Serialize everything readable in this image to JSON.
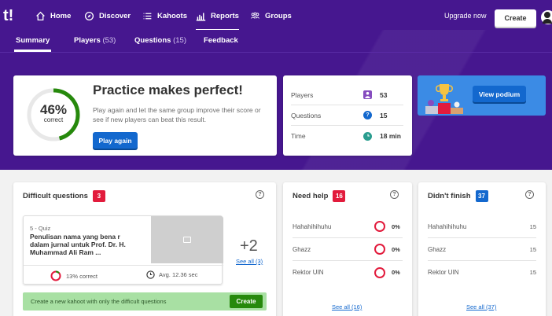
{
  "app": {
    "logo": "t!"
  },
  "nav": {
    "items": [
      {
        "label": "Home",
        "icon": "home-icon"
      },
      {
        "label": "Discover",
        "icon": "compass-icon"
      },
      {
        "label": "Kahoots",
        "icon": "list-icon"
      },
      {
        "label": "Reports",
        "icon": "bar-chart-icon",
        "active": true
      },
      {
        "label": "Groups",
        "icon": "groups-icon"
      }
    ],
    "upgrade_label": "Upgrade now",
    "create_label": "Create"
  },
  "tabs": [
    {
      "label": "Summary",
      "count": "",
      "active": true
    },
    {
      "label": "Players",
      "count": "(53)"
    },
    {
      "label": "Questions",
      "count": "(15)"
    },
    {
      "label": "Feedback",
      "count": ""
    }
  ],
  "summary": {
    "percent": "46%",
    "percent_value": 46,
    "percent_label": "correct",
    "title": "Practice makes perfect!",
    "text": "Play again and let the same group improve their score or see if new players can beat this result.",
    "play_again_label": "Play again"
  },
  "stats": [
    {
      "label": "Players",
      "value": "53",
      "icon": "person-icon",
      "color": "#864cbf"
    },
    {
      "label": "Questions",
      "value": "15",
      "icon": "question-icon",
      "color": "#1368ce"
    },
    {
      "label": "Time",
      "value": "18 min",
      "icon": "clock-icon",
      "color": "#2a9d8f"
    }
  ],
  "podium": {
    "button_label": "View podium"
  },
  "difficult": {
    "title": "Difficult questions",
    "count": "3",
    "question": {
      "type": "5 - Quiz",
      "text": "Penulisan nama yang bena r dalam jurnal untuk Prof. Dr. H. Muhammad Ali Ram ...",
      "correct": "13% correct",
      "correct_value": 13,
      "avg_time": "Avg. 12.36 sec"
    },
    "more": "+2",
    "see_all": "See all (3)",
    "banner_text": "Create a new kahoot with only the difficult questions",
    "create_label": "Create"
  },
  "need_help": {
    "title": "Need help",
    "count": "16",
    "rows": [
      {
        "name": "Hahahihihuhu",
        "pct": "0%"
      },
      {
        "name": "Ghazz",
        "pct": "0%"
      },
      {
        "name": "Rektor UIN",
        "pct": "0%"
      }
    ],
    "see_all": "See all (16)"
  },
  "didnt_finish": {
    "title": "Didn't finish",
    "count": "37",
    "rows": [
      {
        "name": "Hahahihihuhu",
        "value": "15"
      },
      {
        "name": "Ghazz",
        "value": "15"
      },
      {
        "name": "Rektor UIN",
        "value": "15"
      }
    ],
    "see_all": "See all (37)"
  },
  "colors": {
    "brand": "#46178f",
    "blue": "#1368ce",
    "red": "#e21b3c",
    "green": "#26890c"
  }
}
